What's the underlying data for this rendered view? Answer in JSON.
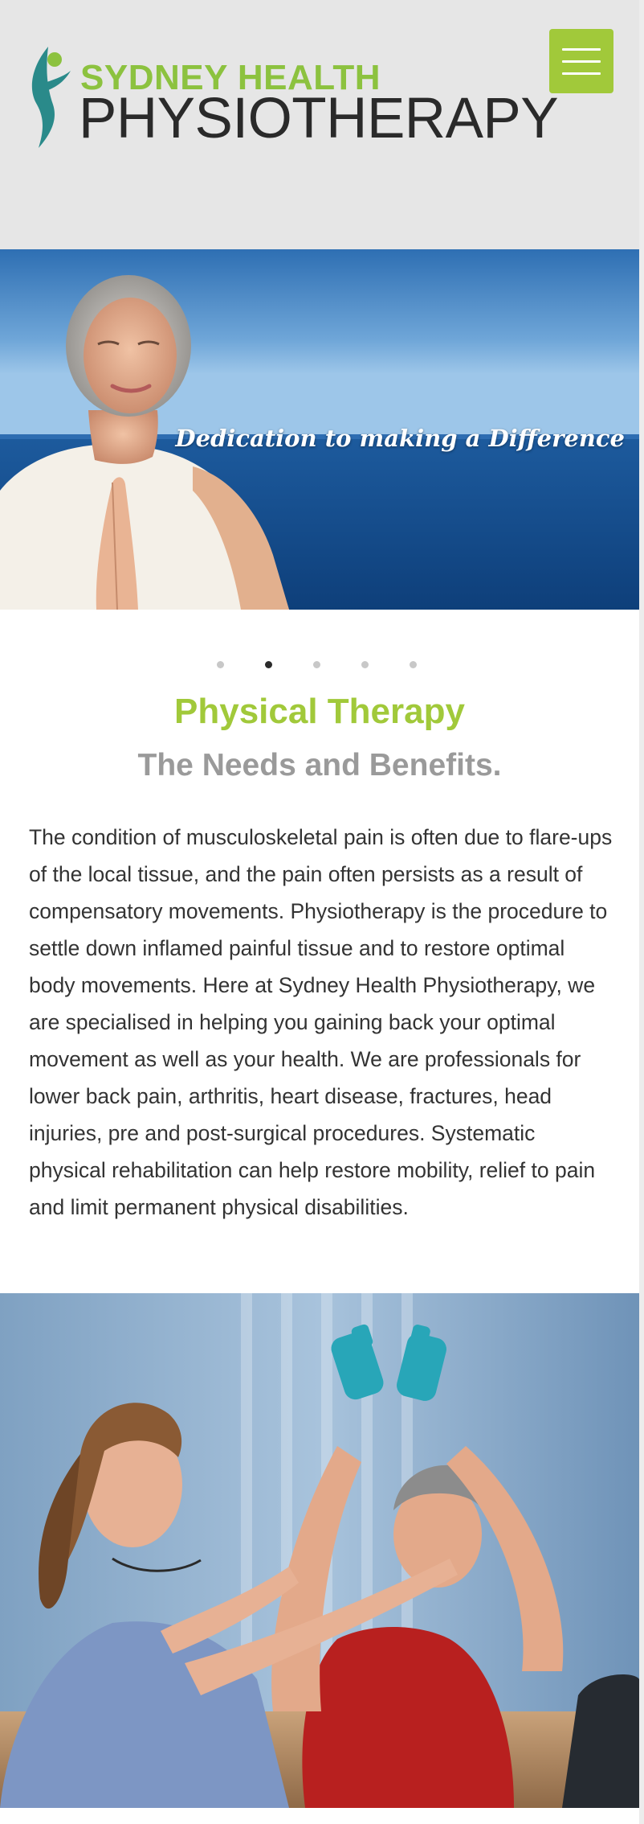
{
  "header": {
    "logo_line1": "SYDNEY HEALTH",
    "logo_line2": "PHYSIOTHERAPY",
    "menu_icon": "hamburger-menu-icon"
  },
  "hero": {
    "caption": "Dedication to making a Difference",
    "slides": 5,
    "active_slide": 2
  },
  "content": {
    "title": "Physical Therapy",
    "subtitle": "The Needs and Benefits.",
    "body": "The condition of musculoskeletal pain is often due to flare-ups of the local tissue, and the pain often persists as a result of compensatory movements. Physiotherapy is the procedure to settle down inflamed painful tissue and to restore optimal body movements. Here at Sydney Health Physiotherapy, we are specialised in helping you gaining back your optimal movement as well as your health. We are professionals for lower back pain, arthritis, heart disease, fractures, head injuries, pre and post-surgical procedures. Systematic physical rehabilitation can help restore mobility, relief to pain and limit permanent physical disabilities."
  },
  "colors": {
    "brand_green": "#a1c93a",
    "logo_green": "#8cc23f",
    "logo_teal": "#2a8a8a",
    "subtitle_gray": "#9a9a9a",
    "header_bg": "#e6e6e6"
  }
}
